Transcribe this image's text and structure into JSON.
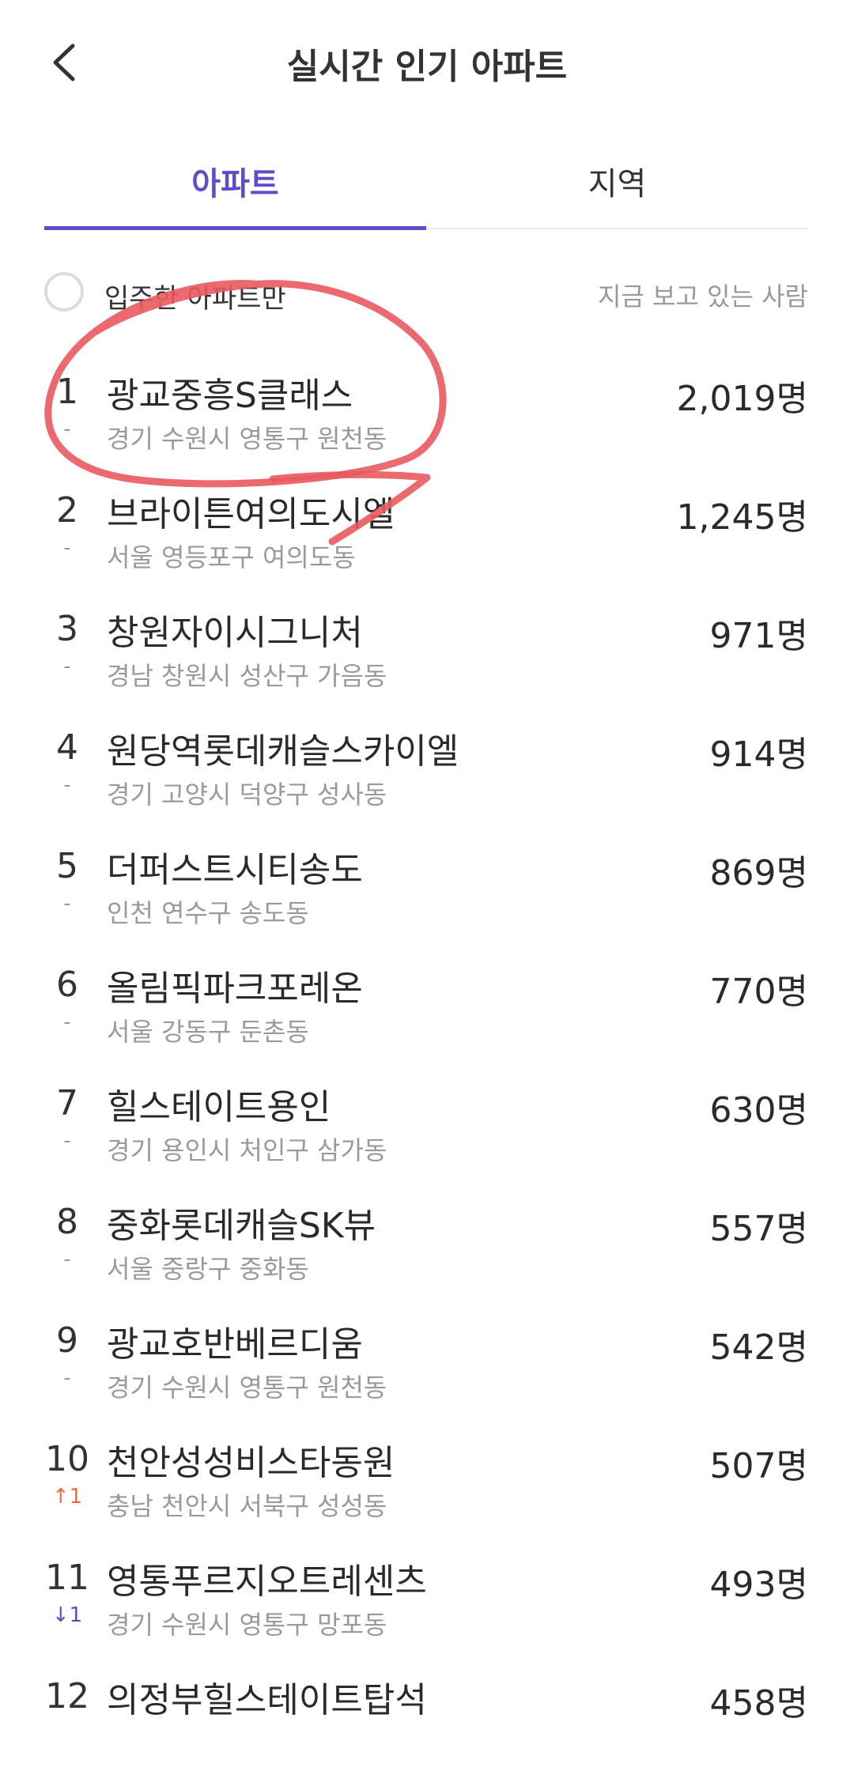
{
  "header": {
    "title": "실시간 인기 아파트"
  },
  "tabs": [
    {
      "label": "아파트",
      "active": true
    },
    {
      "label": "지역",
      "active": false
    }
  ],
  "filter": {
    "checkbox_label": "입주한 아파트만",
    "right_label": "지금 보고 있는 사람"
  },
  "list": [
    {
      "rank": "1",
      "change": "-",
      "name": "광교중흥S클래스",
      "location": "경기 수원시 영통구 원천동",
      "count": "2,019명"
    },
    {
      "rank": "2",
      "change": "-",
      "name": "브라이튼여의도시엘",
      "location": "서울 영등포구 여의도동",
      "count": "1,245명"
    },
    {
      "rank": "3",
      "change": "-",
      "name": "창원자이시그니처",
      "location": "경남 창원시 성산구 가음동",
      "count": "971명"
    },
    {
      "rank": "4",
      "change": "-",
      "name": "원당역롯데캐슬스카이엘",
      "location": "경기 고양시 덕양구 성사동",
      "count": "914명"
    },
    {
      "rank": "5",
      "change": "-",
      "name": "더퍼스트시티송도",
      "location": "인천 연수구 송도동",
      "count": "869명"
    },
    {
      "rank": "6",
      "change": "-",
      "name": "올림픽파크포레온",
      "location": "서울 강동구 둔촌동",
      "count": "770명"
    },
    {
      "rank": "7",
      "change": "-",
      "name": "힐스테이트용인",
      "location": "경기 용인시 처인구 삼가동",
      "count": "630명"
    },
    {
      "rank": "8",
      "change": "-",
      "name": "중화롯데캐슬SK뷰",
      "location": "서울 중랑구 중화동",
      "count": "557명"
    },
    {
      "rank": "9",
      "change": "-",
      "name": "광교호반베르디움",
      "location": "경기 수원시 영통구 원천동",
      "count": "542명"
    },
    {
      "rank": "10",
      "change": "↑1",
      "name": "천안성성비스타동원",
      "location": "충남 천안시 서북구 성성동",
      "count": "507명"
    },
    {
      "rank": "11",
      "change": "↓1",
      "name": "영통푸르지오트레센츠",
      "location": "경기 수원시 영통구 망포동",
      "count": "493명"
    },
    {
      "rank": "12",
      "change": "",
      "name": "의정부힐스테이트탑석",
      "location": "",
      "count": "458명"
    }
  ],
  "colors": {
    "accent": "#5b4fc9",
    "rank_up": "#ef6d3d",
    "rank_down": "#5b4fc9",
    "annotation": "#e85a5f"
  }
}
